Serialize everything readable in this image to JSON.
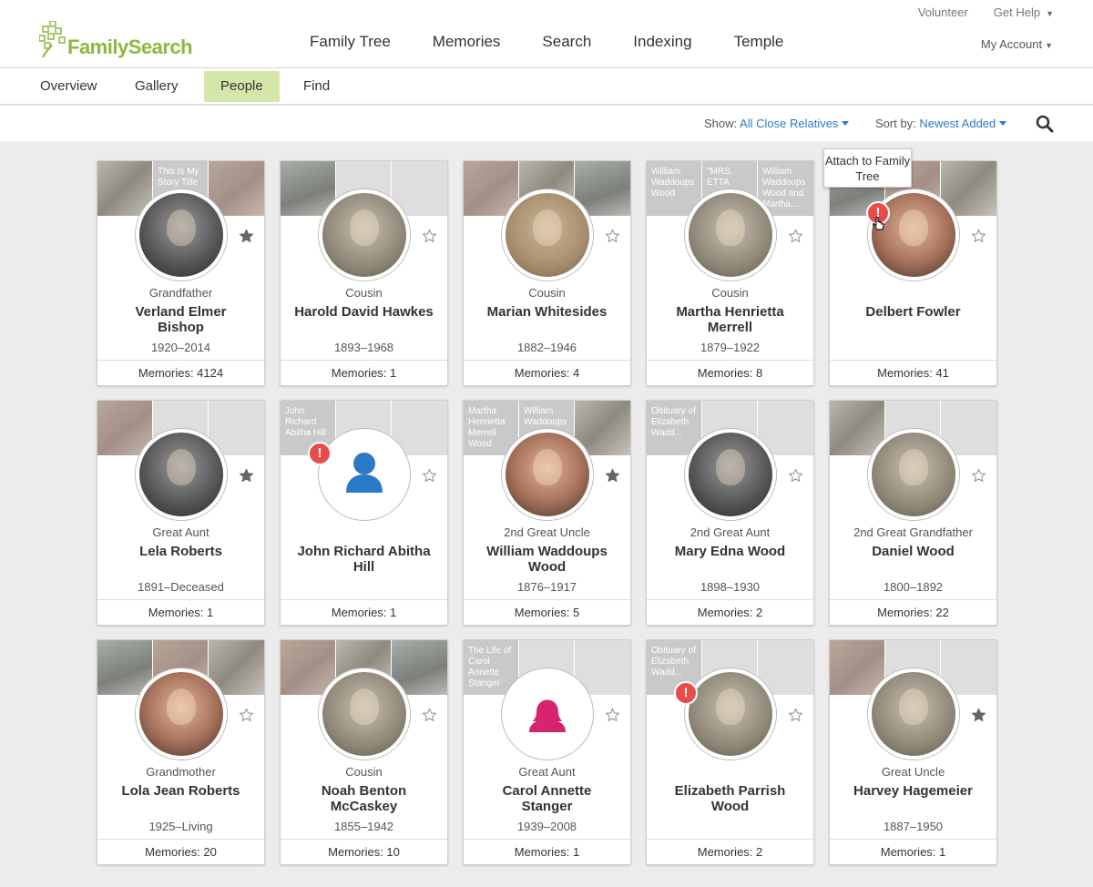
{
  "header": {
    "logo_text": "FamilySearch",
    "nav": [
      "Family Tree",
      "Memories",
      "Search",
      "Indexing",
      "Temple"
    ],
    "volunteer": "Volunteer",
    "get_help": "Get Help",
    "my_account": "My Account"
  },
  "subnav": {
    "tabs": [
      "Overview",
      "Gallery",
      "People",
      "Find"
    ],
    "active": "People"
  },
  "toolbar": {
    "show_label": "Show:",
    "show_value": "All Close Relatives",
    "sort_label": "Sort by:",
    "sort_value": "Newest Added"
  },
  "tooltip": "Attach to Family Tree",
  "colors": {
    "brand_green": "#8cb83b",
    "active_tab": "#d5e7a8",
    "link_blue": "#2a7ac7",
    "alert_red": "#e84b4b",
    "male_blue": "#2a7ac7",
    "female_pink": "#d6246e"
  },
  "cards": [
    {
      "relationship": "Grandfather",
      "name": "Verland Elmer Bishop",
      "dates": "1920–2014",
      "memories": "Memories: 4124",
      "starred": true,
      "thumbs": [
        "",
        "This Is My Story Title",
        ""
      ]
    },
    {
      "relationship": "Cousin",
      "name": "Harold David Hawkes",
      "dates": "1893–1968",
      "memories": "Memories: 1",
      "starred": false,
      "thumbs": [
        "",
        "",
        ""
      ]
    },
    {
      "relationship": "Cousin",
      "name": "Marian Whitesides",
      "dates": "1882–1946",
      "memories": "Memories: 4",
      "starred": false,
      "thumbs": [
        "",
        "",
        ""
      ]
    },
    {
      "relationship": "Cousin",
      "name": "Martha Henrietta Merrell",
      "dates": "1879–1922",
      "memories": "Memories: 8",
      "starred": false,
      "thumbs": [
        "William Waddoups Wood",
        "\"MRS. ETTA",
        "William Waddoups Wood and Martha..."
      ]
    },
    {
      "relationship": "",
      "name": "Delbert Fowler",
      "dates": "",
      "memories": "Memories: 41",
      "starred": false,
      "alert": true,
      "thumbs": [
        "",
        "",
        ""
      ]
    },
    {
      "relationship": "Great Aunt",
      "name": "Lela Roberts",
      "dates": "1891–Deceased",
      "memories": "Memories: 1",
      "starred": true,
      "thumbs": [
        "",
        "",
        ""
      ]
    },
    {
      "relationship": "",
      "name": "John Richard Abitha Hill",
      "dates": "",
      "memories": "Memories: 1",
      "starred": false,
      "alert": true,
      "silhouette": "male",
      "thumbs": [
        "John Richard Abitha Hill",
        "",
        ""
      ]
    },
    {
      "relationship": "2nd Great Uncle",
      "name": "William Waddoups Wood",
      "dates": "1876–1917",
      "memories": "Memories: 5",
      "starred": true,
      "thumbs": [
        "Martha Henrietta Merrell Wood",
        "William Waddoups",
        ""
      ]
    },
    {
      "relationship": "2nd Great Aunt",
      "name": "Mary Edna Wood",
      "dates": "1898–1930",
      "memories": "Memories: 2",
      "starred": false,
      "thumbs": [
        "Obituary of Elizabeth Wadd...",
        "",
        ""
      ]
    },
    {
      "relationship": "2nd Great Grandfather",
      "name": "Daniel Wood",
      "dates": "1800–1892",
      "memories": "Memories: 22",
      "starred": false,
      "thumbs": [
        "",
        "",
        ""
      ]
    },
    {
      "relationship": "Grandmother",
      "name": "Lola Jean Roberts",
      "dates": "1925–Living",
      "memories": "Memories: 20",
      "starred": false,
      "thumbs": [
        "",
        "",
        ""
      ]
    },
    {
      "relationship": "Cousin",
      "name": "Noah Benton McCaskey",
      "dates": "1855–1942",
      "memories": "Memories: 10",
      "starred": false,
      "thumbs": [
        "",
        "",
        ""
      ]
    },
    {
      "relationship": "Great Aunt",
      "name": "Carol Annette Stanger",
      "dates": "1939–2008",
      "memories": "Memories: 1",
      "starred": false,
      "silhouette": "female",
      "thumbs": [
        "The Life of Carol Annette Stanger",
        "",
        ""
      ]
    },
    {
      "relationship": "",
      "name": "Elizabeth Parrish Wood",
      "dates": "",
      "memories": "Memories: 2",
      "starred": false,
      "alert": true,
      "thumbs": [
        "Obituary of Elizabeth Wadd...",
        "",
        ""
      ]
    },
    {
      "relationship": "Great Uncle",
      "name": "Harvey Hagemeier",
      "dates": "1887–1950",
      "memories": "Memories: 1",
      "starred": true,
      "thumbs": [
        "",
        "",
        ""
      ]
    }
  ]
}
